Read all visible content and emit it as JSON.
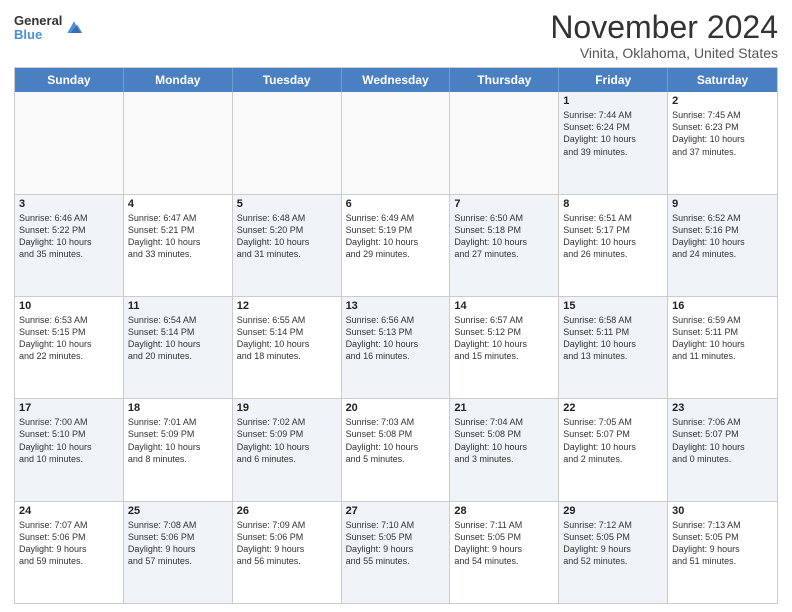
{
  "logo": {
    "general": "General",
    "blue": "Blue"
  },
  "title": "November 2024",
  "location": "Vinita, Oklahoma, United States",
  "header_days": [
    "Sunday",
    "Monday",
    "Tuesday",
    "Wednesday",
    "Thursday",
    "Friday",
    "Saturday"
  ],
  "weeks": [
    [
      {
        "day": "",
        "info": "",
        "shaded": false,
        "empty": true
      },
      {
        "day": "",
        "info": "",
        "shaded": false,
        "empty": true
      },
      {
        "day": "",
        "info": "",
        "shaded": false,
        "empty": true
      },
      {
        "day": "",
        "info": "",
        "shaded": false,
        "empty": true
      },
      {
        "day": "",
        "info": "",
        "shaded": false,
        "empty": true
      },
      {
        "day": "1",
        "info": "Sunrise: 7:44 AM\nSunset: 6:24 PM\nDaylight: 10 hours\nand 39 minutes.",
        "shaded": true,
        "empty": false
      },
      {
        "day": "2",
        "info": "Sunrise: 7:45 AM\nSunset: 6:23 PM\nDaylight: 10 hours\nand 37 minutes.",
        "shaded": false,
        "empty": false
      }
    ],
    [
      {
        "day": "3",
        "info": "Sunrise: 6:46 AM\nSunset: 5:22 PM\nDaylight: 10 hours\nand 35 minutes.",
        "shaded": true,
        "empty": false
      },
      {
        "day": "4",
        "info": "Sunrise: 6:47 AM\nSunset: 5:21 PM\nDaylight: 10 hours\nand 33 minutes.",
        "shaded": false,
        "empty": false
      },
      {
        "day": "5",
        "info": "Sunrise: 6:48 AM\nSunset: 5:20 PM\nDaylight: 10 hours\nand 31 minutes.",
        "shaded": true,
        "empty": false
      },
      {
        "day": "6",
        "info": "Sunrise: 6:49 AM\nSunset: 5:19 PM\nDaylight: 10 hours\nand 29 minutes.",
        "shaded": false,
        "empty": false
      },
      {
        "day": "7",
        "info": "Sunrise: 6:50 AM\nSunset: 5:18 PM\nDaylight: 10 hours\nand 27 minutes.",
        "shaded": true,
        "empty": false
      },
      {
        "day": "8",
        "info": "Sunrise: 6:51 AM\nSunset: 5:17 PM\nDaylight: 10 hours\nand 26 minutes.",
        "shaded": false,
        "empty": false
      },
      {
        "day": "9",
        "info": "Sunrise: 6:52 AM\nSunset: 5:16 PM\nDaylight: 10 hours\nand 24 minutes.",
        "shaded": true,
        "empty": false
      }
    ],
    [
      {
        "day": "10",
        "info": "Sunrise: 6:53 AM\nSunset: 5:15 PM\nDaylight: 10 hours\nand 22 minutes.",
        "shaded": false,
        "empty": false
      },
      {
        "day": "11",
        "info": "Sunrise: 6:54 AM\nSunset: 5:14 PM\nDaylight: 10 hours\nand 20 minutes.",
        "shaded": true,
        "empty": false
      },
      {
        "day": "12",
        "info": "Sunrise: 6:55 AM\nSunset: 5:14 PM\nDaylight: 10 hours\nand 18 minutes.",
        "shaded": false,
        "empty": false
      },
      {
        "day": "13",
        "info": "Sunrise: 6:56 AM\nSunset: 5:13 PM\nDaylight: 10 hours\nand 16 minutes.",
        "shaded": true,
        "empty": false
      },
      {
        "day": "14",
        "info": "Sunrise: 6:57 AM\nSunset: 5:12 PM\nDaylight: 10 hours\nand 15 minutes.",
        "shaded": false,
        "empty": false
      },
      {
        "day": "15",
        "info": "Sunrise: 6:58 AM\nSunset: 5:11 PM\nDaylight: 10 hours\nand 13 minutes.",
        "shaded": true,
        "empty": false
      },
      {
        "day": "16",
        "info": "Sunrise: 6:59 AM\nSunset: 5:11 PM\nDaylight: 10 hours\nand 11 minutes.",
        "shaded": false,
        "empty": false
      }
    ],
    [
      {
        "day": "17",
        "info": "Sunrise: 7:00 AM\nSunset: 5:10 PM\nDaylight: 10 hours\nand 10 minutes.",
        "shaded": true,
        "empty": false
      },
      {
        "day": "18",
        "info": "Sunrise: 7:01 AM\nSunset: 5:09 PM\nDaylight: 10 hours\nand 8 minutes.",
        "shaded": false,
        "empty": false
      },
      {
        "day": "19",
        "info": "Sunrise: 7:02 AM\nSunset: 5:09 PM\nDaylight: 10 hours\nand 6 minutes.",
        "shaded": true,
        "empty": false
      },
      {
        "day": "20",
        "info": "Sunrise: 7:03 AM\nSunset: 5:08 PM\nDaylight: 10 hours\nand 5 minutes.",
        "shaded": false,
        "empty": false
      },
      {
        "day": "21",
        "info": "Sunrise: 7:04 AM\nSunset: 5:08 PM\nDaylight: 10 hours\nand 3 minutes.",
        "shaded": true,
        "empty": false
      },
      {
        "day": "22",
        "info": "Sunrise: 7:05 AM\nSunset: 5:07 PM\nDaylight: 10 hours\nand 2 minutes.",
        "shaded": false,
        "empty": false
      },
      {
        "day": "23",
        "info": "Sunrise: 7:06 AM\nSunset: 5:07 PM\nDaylight: 10 hours\nand 0 minutes.",
        "shaded": true,
        "empty": false
      }
    ],
    [
      {
        "day": "24",
        "info": "Sunrise: 7:07 AM\nSunset: 5:06 PM\nDaylight: 9 hours\nand 59 minutes.",
        "shaded": false,
        "empty": false
      },
      {
        "day": "25",
        "info": "Sunrise: 7:08 AM\nSunset: 5:06 PM\nDaylight: 9 hours\nand 57 minutes.",
        "shaded": true,
        "empty": false
      },
      {
        "day": "26",
        "info": "Sunrise: 7:09 AM\nSunset: 5:06 PM\nDaylight: 9 hours\nand 56 minutes.",
        "shaded": false,
        "empty": false
      },
      {
        "day": "27",
        "info": "Sunrise: 7:10 AM\nSunset: 5:05 PM\nDaylight: 9 hours\nand 55 minutes.",
        "shaded": true,
        "empty": false
      },
      {
        "day": "28",
        "info": "Sunrise: 7:11 AM\nSunset: 5:05 PM\nDaylight: 9 hours\nand 54 minutes.",
        "shaded": false,
        "empty": false
      },
      {
        "day": "29",
        "info": "Sunrise: 7:12 AM\nSunset: 5:05 PM\nDaylight: 9 hours\nand 52 minutes.",
        "shaded": true,
        "empty": false
      },
      {
        "day": "30",
        "info": "Sunrise: 7:13 AM\nSunset: 5:05 PM\nDaylight: 9 hours\nand 51 minutes.",
        "shaded": false,
        "empty": false
      }
    ]
  ]
}
